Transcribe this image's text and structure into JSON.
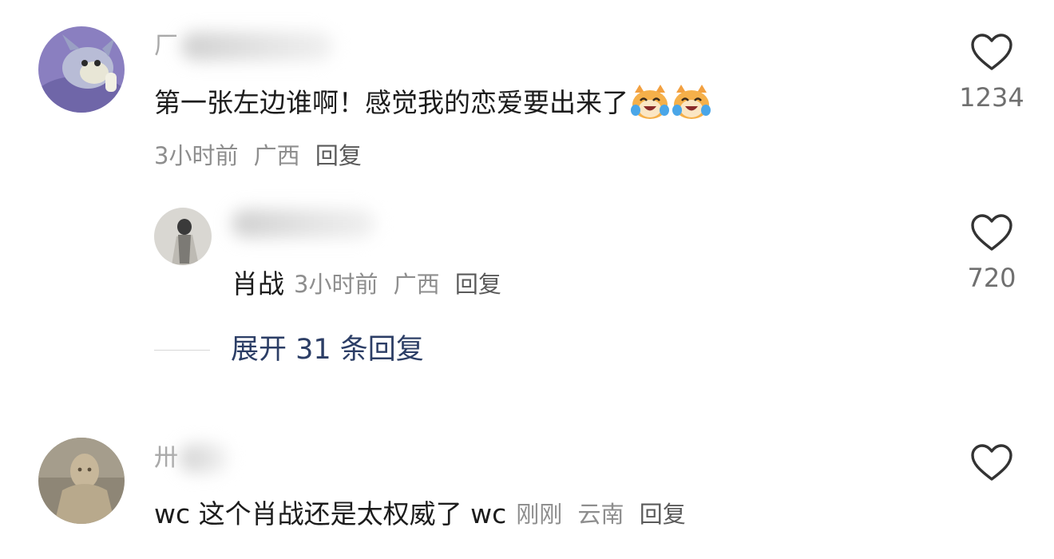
{
  "comments": [
    {
      "username_initial": "厂",
      "text": "第一张左边谁啊！感觉我的恋爱要出来了",
      "emoji": "cat-laughing-tears-emoji",
      "time": "3小时前",
      "location": "广西",
      "reply_label": "回复",
      "likes": "1234"
    },
    {
      "username_initial": "",
      "text": "肖战",
      "time": "3小时前",
      "location": "广西",
      "reply_label": "回复",
      "likes": "720"
    },
    {
      "username_initial": "卅",
      "text": "wc 这个肖战还是太权威了 wc",
      "time": "刚刚",
      "location": "云南",
      "reply_label": "回复",
      "likes": ""
    }
  ],
  "expand_replies": "展开 31 条回复",
  "colors": {
    "link": "#2c3e66",
    "meta": "#8e8e8e",
    "text": "#1c1c1c"
  }
}
